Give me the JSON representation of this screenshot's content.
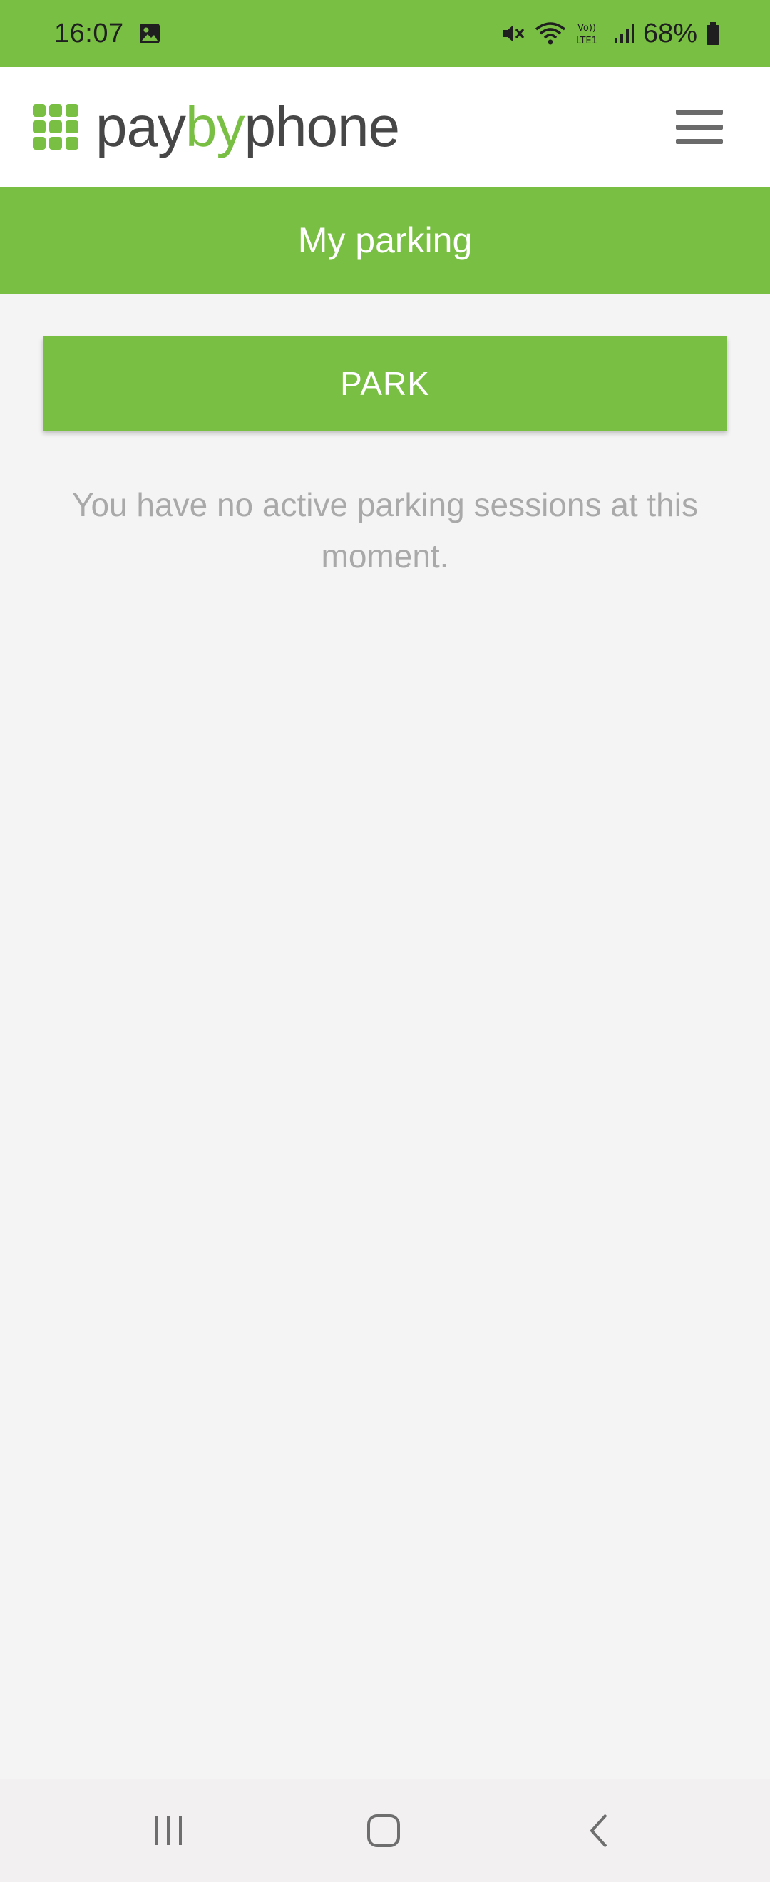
{
  "status_bar": {
    "time": "16:07",
    "battery": "68%",
    "icons": [
      "gallery-icon",
      "mute-icon",
      "wifi-icon",
      "volte-icon",
      "signal-icon",
      "battery-icon"
    ]
  },
  "header": {
    "logo_pay": "pay",
    "logo_by": "by",
    "logo_phone": "phone",
    "menu_icon": "hamburger-menu-icon"
  },
  "title": "My parking",
  "park_button_label": "PARK",
  "empty_message": "You have no active parking sessions at this moment.",
  "nav": {
    "recents_icon": "recents-icon",
    "home_icon": "home-icon",
    "back_icon": "back-icon"
  },
  "colors": {
    "brand_green": "#79bf43",
    "logo_gray": "#474747",
    "background": "#f4f4f4",
    "muted_text": "#a9a9a9"
  }
}
